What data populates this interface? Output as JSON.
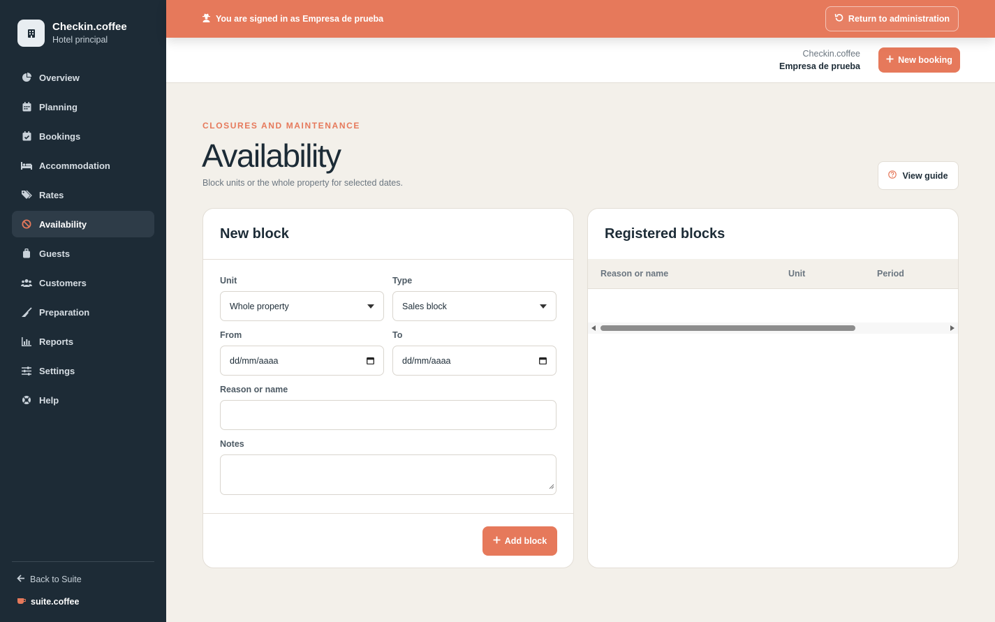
{
  "brand": {
    "name": "Checkin.coffee",
    "subtitle": "Hotel principal"
  },
  "sidebar": {
    "items": [
      {
        "label": "Overview",
        "icon": "pie-chart-icon"
      },
      {
        "label": "Planning",
        "icon": "calendar-grid-icon"
      },
      {
        "label": "Bookings",
        "icon": "calendar-check-icon"
      },
      {
        "label": "Accommodation",
        "icon": "bed-icon"
      },
      {
        "label": "Rates",
        "icon": "tags-icon"
      },
      {
        "label": "Availability",
        "icon": "ban-icon",
        "active": true
      },
      {
        "label": "Guests",
        "icon": "suitcase-icon"
      },
      {
        "label": "Customers",
        "icon": "users-icon"
      },
      {
        "label": "Preparation",
        "icon": "broom-icon"
      },
      {
        "label": "Reports",
        "icon": "bar-chart-icon"
      },
      {
        "label": "Settings",
        "icon": "sliders-icon"
      },
      {
        "label": "Help",
        "icon": "lifebuoy-icon"
      }
    ],
    "back_label": "Back to Suite",
    "suite_brand": "suite.coffee"
  },
  "banner": {
    "message": "You are signed in as Empresa de prueba",
    "return_label": "Return to administration"
  },
  "header": {
    "account_app": "Checkin.coffee",
    "account_name": "Empresa de prueba",
    "new_booking_label": "New booking"
  },
  "page": {
    "eyebrow": "CLOSURES AND MAINTENANCE",
    "title": "Availability",
    "subtitle": "Block units or the whole property for selected dates.",
    "guide_label": "View guide"
  },
  "new_block": {
    "title": "New block",
    "unit_label": "Unit",
    "unit_value": "Whole property",
    "type_label": "Type",
    "type_value": "Sales block",
    "from_label": "From",
    "from_placeholder": "dd/mm/aaaa",
    "to_label": "To",
    "to_placeholder": "dd/mm/aaaa",
    "reason_label": "Reason or name",
    "reason_value": "",
    "notes_label": "Notes",
    "notes_value": "",
    "add_label": "Add block"
  },
  "registered_blocks": {
    "title": "Registered blocks",
    "columns": [
      "Reason or name",
      "Unit",
      "Period"
    ],
    "rows": []
  },
  "colors": {
    "accent": "#e6795b",
    "sidebar": "#1d2b36",
    "background": "#f3f0ea"
  }
}
